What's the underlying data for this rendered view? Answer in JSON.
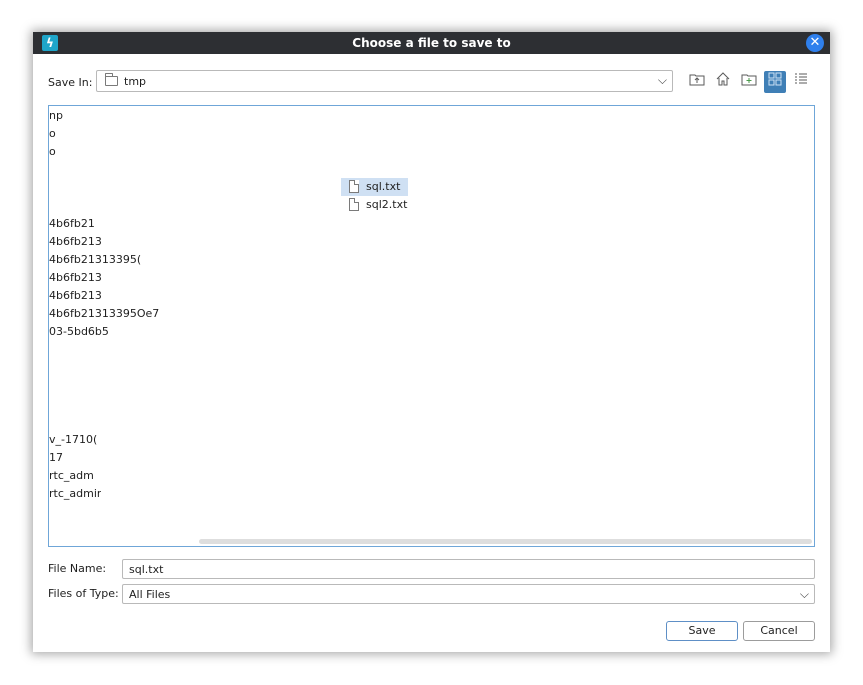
{
  "window": {
    "title": "Choose a file to save to",
    "app_icon": "lightning-bolt-icon",
    "close_icon": "close-icon"
  },
  "toolbar": {
    "save_in_label": "Save In:",
    "location": "tmp",
    "buttons": [
      {
        "name": "up-one-level",
        "icon": "folder-up-icon"
      },
      {
        "name": "home",
        "icon": "home-icon"
      },
      {
        "name": "new-folder",
        "icon": "new-folder-icon"
      },
      {
        "name": "list-view",
        "icon": "grid-view-icon",
        "active": true
      },
      {
        "name": "details-view",
        "icon": "details-view-icon"
      }
    ]
  },
  "file_list": {
    "column1": [
      "np",
      "o",
      "o",
      "",
      "",
      "",
      "4b6fb21",
      "4b6fb213",
      "4b6fb21313395(",
      "4b6fb213",
      "4b6fb213",
      "4b6fb21313395Oe7",
      "03-5bd6b5",
      "",
      "",
      "",
      "",
      "",
      "v_-1710(",
      "17",
      "rtc_adm",
      "rtc_admir"
    ],
    "files": [
      {
        "name": "sql.txt",
        "selected": true
      },
      {
        "name": "sql2.txt",
        "selected": false
      }
    ]
  },
  "form": {
    "file_name_label": "File Name:",
    "file_name_value": "sql.txt",
    "file_type_label": "Files of Type:",
    "file_type_value": "All Files"
  },
  "buttons": {
    "save": "Save",
    "cancel": "Cancel"
  },
  "colors": {
    "titlebar": "#2d2f33",
    "accent": "#3f7fb6",
    "selection": "#cfe0f3",
    "close": "#2f80ed"
  }
}
